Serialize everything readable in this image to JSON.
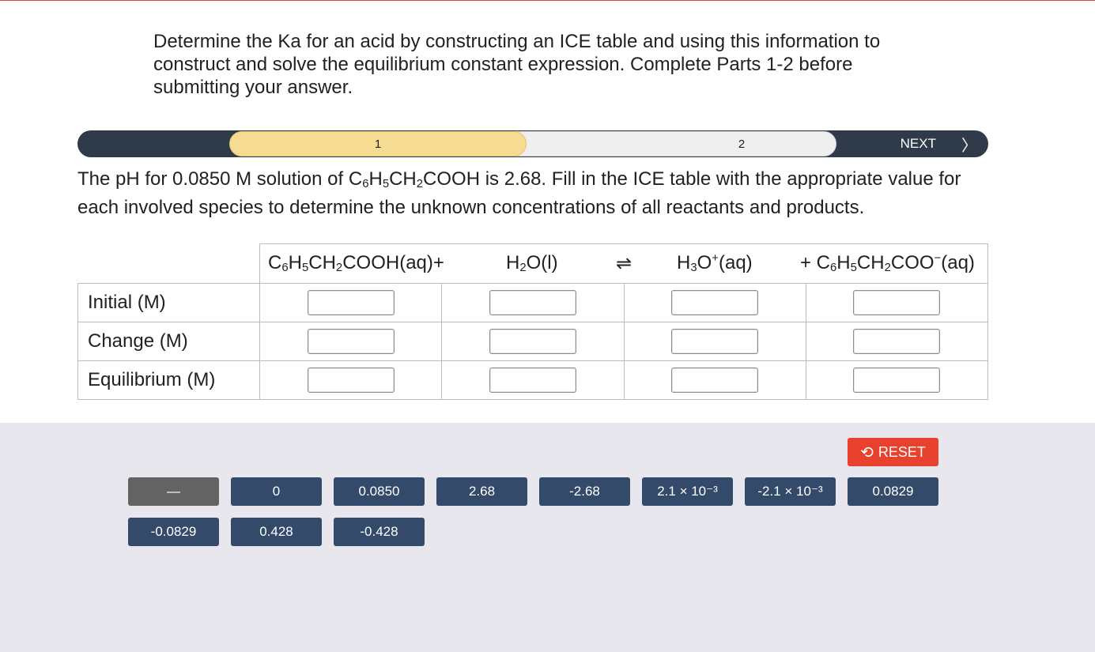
{
  "intro": "Determine the Ka for an acid by constructing an ICE table and using this information to construct and solve the equilibrium constant expression. Complete Parts 1-2 before submitting your answer.",
  "progress": {
    "step1": "1",
    "step2": "2",
    "next_label": "NEXT",
    "next_icon": "chevron-right-icon"
  },
  "question": {
    "pre": "The pH for 0.0850 M solution of C",
    "s1": "6",
    "m1": "H",
    "s2": "5",
    "m2": "CH",
    "s3": "2",
    "post": "COOH is 2.68. Fill in the ICE table with the appropriate value for each involved species to determine the unknown concentrations of all reactants and products."
  },
  "table": {
    "species": [
      "C6H5CH2COOH(aq)+",
      "H2O(l)",
      "⇌",
      "H3O+(aq)",
      "+ C6H5CH2COO−(aq)"
    ],
    "rows": [
      "Initial (M)",
      "Change (M)",
      "Equilibrium (M)"
    ]
  },
  "bank": {
    "reset_label": "RESET",
    "reset_icon": "undo-icon",
    "tiles": [
      "—",
      "0",
      "0.0850",
      "2.68",
      "-2.68",
      "2.1 × 10⁻³",
      "-2.1 × 10⁻³",
      "0.0829",
      "-0.0829",
      "0.428",
      "-0.428"
    ]
  },
  "colors": {
    "progress_track": "#2f3a4a",
    "active_step": "#f5dc92",
    "tile": "#334a6b",
    "tile_dash": "#636363",
    "reset": "#e8422f",
    "bank_bg": "#e8e7ee"
  }
}
